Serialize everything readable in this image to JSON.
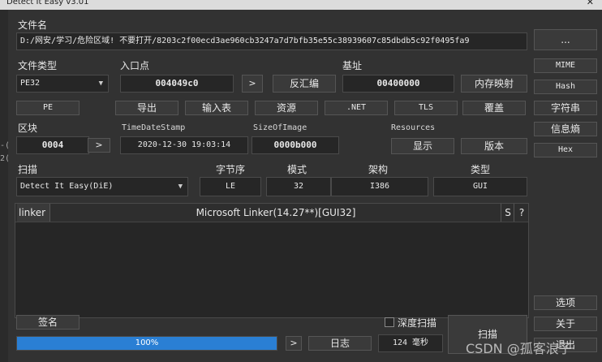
{
  "window": {
    "title": "Detect It Easy v3.01",
    "close_glyph": "✕"
  },
  "file": {
    "label": "文件名",
    "path": "D:/网安/学习/危险区域! 不要打开/8203c2f00ecd3ae960cb3247a7d7bfb35e55c38939607c85dbdb5c92f0495fa9",
    "browse_label": "..."
  },
  "filetype": {
    "label": "文件类型",
    "value": "PE32"
  },
  "entry": {
    "label": "入口点",
    "value": "004049c0",
    "go_label": ">",
    "disasm_label": "反汇编"
  },
  "base": {
    "label": "基址",
    "value": "00400000",
    "memmap_label": "内存映射"
  },
  "right_buttons": {
    "mime": "MIME",
    "hash": "Hash",
    "strings": "字符串",
    "entropy": "信息熵",
    "hex": "Hex",
    "options": "选项",
    "about": "关于",
    "exit": "退出"
  },
  "toolbar": {
    "pe": "PE",
    "export": "导出",
    "import": "输入表",
    "resources": "资源",
    "net": ".NET",
    "tls": "TLS",
    "overlay": "覆盖"
  },
  "section": {
    "label": "区块",
    "value": "0004",
    "go_label": ">"
  },
  "timestamp": {
    "label": "TimeDateStamp",
    "value": "2020-12-30 19:03:14"
  },
  "sizeofimage": {
    "label": "SizeOfImage",
    "value": "0000b000"
  },
  "resources": {
    "label": "Resources",
    "show_label": "显示",
    "version_label": "版本"
  },
  "scan": {
    "label": "扫描",
    "engine": "Detect It Easy(DiE)"
  },
  "columns": {
    "endian_label": "字节序",
    "endian_value": "LE",
    "mode_label": "模式",
    "mode_value": "32",
    "arch_label": "架构",
    "arch_value": "I386",
    "type_label": "类型",
    "type_value": "GUI"
  },
  "results": [
    {
      "type": "linker",
      "name": "Microsoft Linker(14.27**)[GUI32]",
      "s": "S",
      "q": "?"
    }
  ],
  "bottom": {
    "sign_label": "签名",
    "deep_scan_label": "深度扫描",
    "progress": 100,
    "progress_text": "100%",
    "more_label": ">",
    "log_label": "日志",
    "time_value": "124 毫秒",
    "scan_button": "扫描"
  },
  "watermark": "CSDN @孤客浪子",
  "left_edge_fragments": [
    "-(",
    "2("
  ]
}
